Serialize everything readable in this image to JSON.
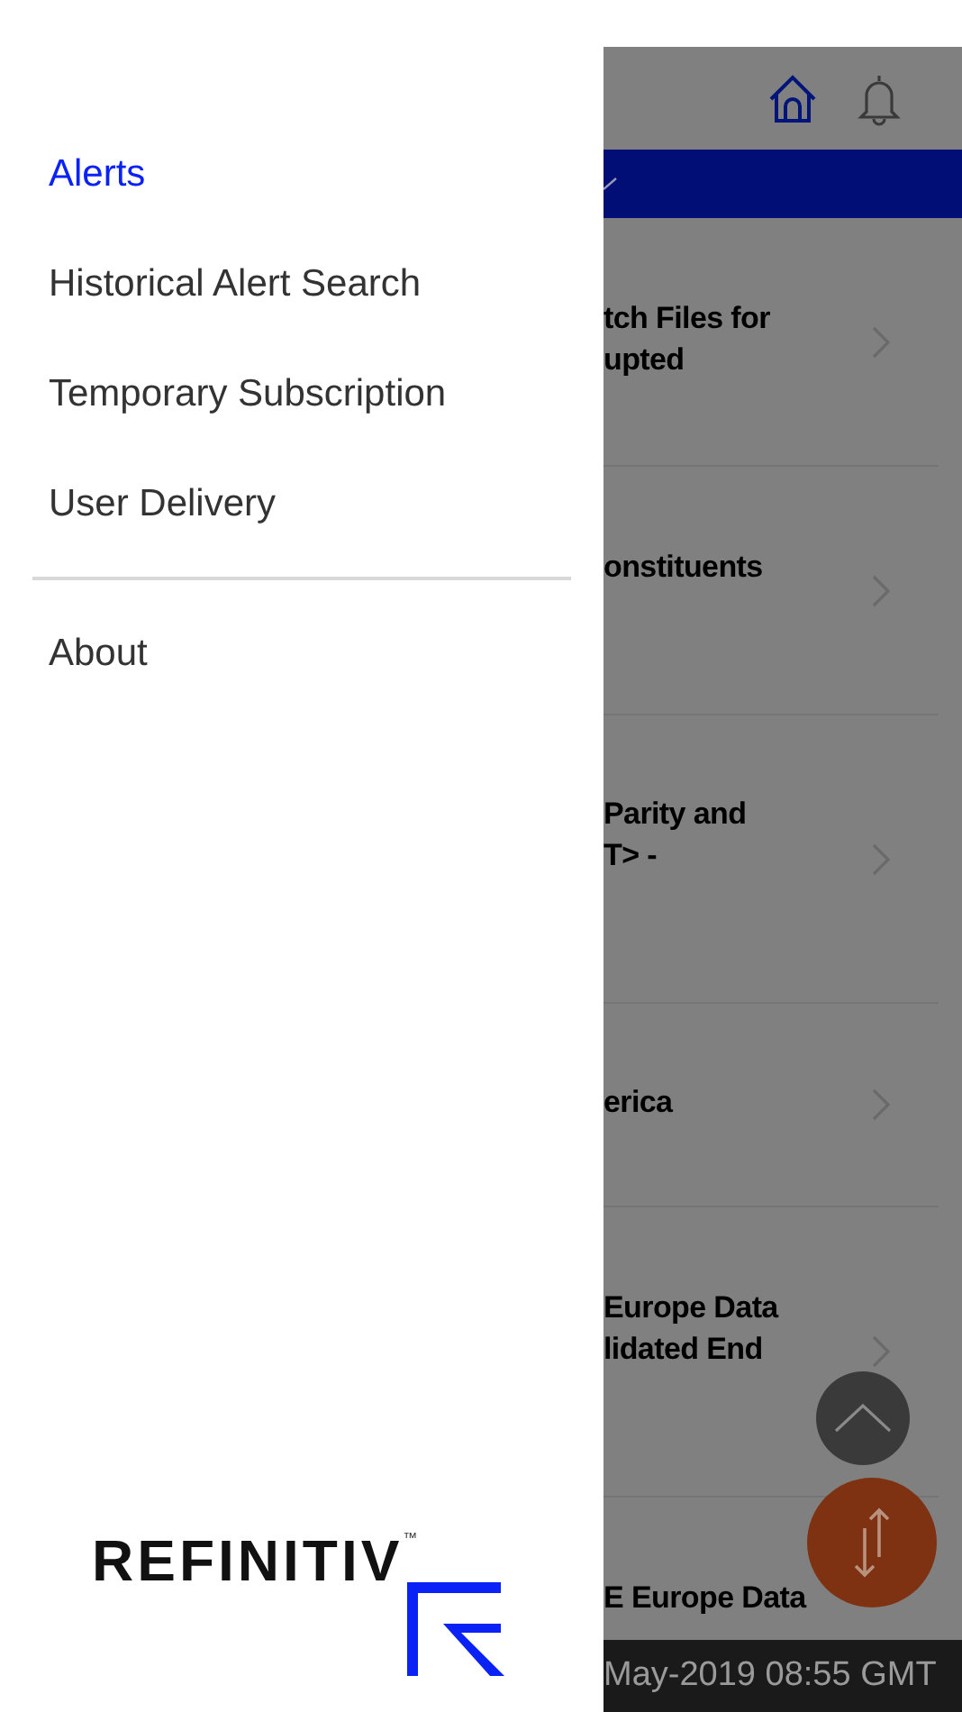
{
  "drawer": {
    "items": [
      {
        "label": "Alerts",
        "selected": true
      },
      {
        "label": "Historical Alert Search",
        "selected": false
      },
      {
        "label": "Temporary Subscription",
        "selected": false
      },
      {
        "label": "User Delivery",
        "selected": false
      }
    ],
    "footer_items": [
      {
        "label": "About",
        "selected": false
      }
    ],
    "logo": {
      "wordmark": "REFINITIV",
      "trademark": "™"
    }
  },
  "background": {
    "rows": [
      {
        "lines": [
          "tch Files for",
          "upted"
        ]
      },
      {
        "lines": [
          "onstituents"
        ]
      },
      {
        "lines": [
          "Parity and",
          "T> -"
        ]
      },
      {
        "lines": [
          "erica"
        ]
      },
      {
        "lines": [
          "Europe Data",
          "lidated End"
        ]
      },
      {
        "lines": [
          "E Europe Data"
        ]
      }
    ],
    "status_bar": "May-2019 08:55 GMT"
  }
}
